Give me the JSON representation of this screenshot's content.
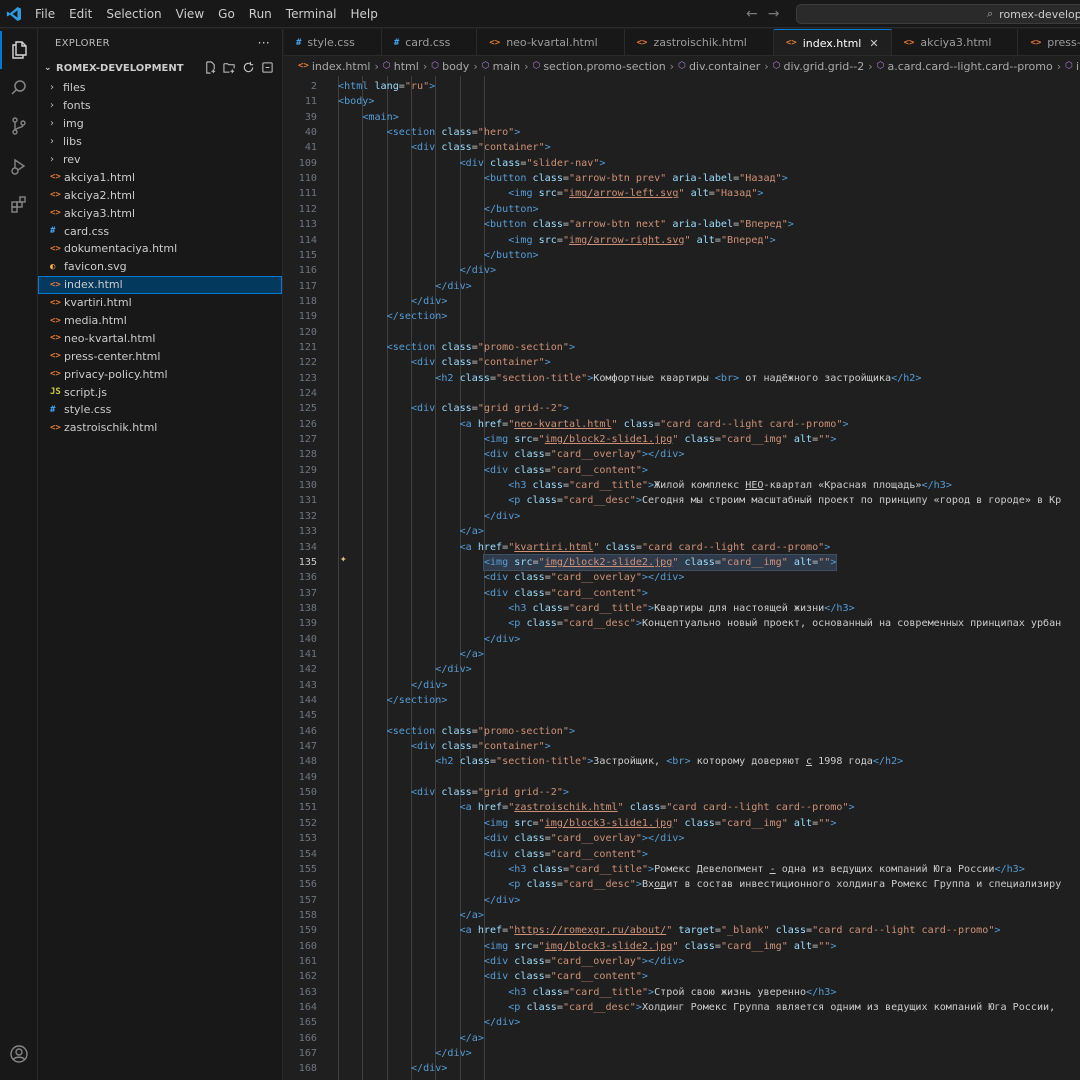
{
  "menu": [
    "File",
    "Edit",
    "Selection",
    "View",
    "Go",
    "Run",
    "Terminal",
    "Help"
  ],
  "command_center": "romex-developme",
  "sidebar": {
    "title": "EXPLORER",
    "section": "ROMEX-DEVELOPMENT",
    "items": [
      {
        "label": "files",
        "kind": "folder"
      },
      {
        "label": "fonts",
        "kind": "folder"
      },
      {
        "label": "img",
        "kind": "folder"
      },
      {
        "label": "libs",
        "kind": "folder"
      },
      {
        "label": "rev",
        "kind": "folder"
      },
      {
        "label": "akciya1.html",
        "kind": "html"
      },
      {
        "label": "akciya2.html",
        "kind": "html"
      },
      {
        "label": "akciya3.html",
        "kind": "html"
      },
      {
        "label": "card.css",
        "kind": "css"
      },
      {
        "label": "dokumentaciya.html",
        "kind": "html"
      },
      {
        "label": "favicon.svg",
        "kind": "svg"
      },
      {
        "label": "index.html",
        "kind": "html",
        "selected": true
      },
      {
        "label": "kvartiri.html",
        "kind": "html"
      },
      {
        "label": "media.html",
        "kind": "html"
      },
      {
        "label": "neo-kvartal.html",
        "kind": "html"
      },
      {
        "label": "press-center.html",
        "kind": "html"
      },
      {
        "label": "privacy-policy.html",
        "kind": "html"
      },
      {
        "label": "script.js",
        "kind": "js"
      },
      {
        "label": "style.css",
        "kind": "css"
      },
      {
        "label": "zastroischik.html",
        "kind": "html"
      }
    ]
  },
  "tabs": [
    {
      "label": "style.css",
      "kind": "css"
    },
    {
      "label": "card.css",
      "kind": "css"
    },
    {
      "label": "neo-kvartal.html",
      "kind": "html"
    },
    {
      "label": "zastroischik.html",
      "kind": "html"
    },
    {
      "label": "index.html",
      "kind": "html",
      "active": true
    },
    {
      "label": "akciya3.html",
      "kind": "html"
    },
    {
      "label": "press-center.html",
      "kind": "html"
    }
  ],
  "breadcrumb": [
    "index.html",
    "html",
    "body",
    "main",
    "section.promo-section",
    "div.container",
    "div.grid.grid--2",
    "a.card.card--light.card--promo",
    "img.card_"
  ],
  "current_line": "135",
  "code_lines": [
    {
      "n": "2",
      "i": 0,
      "h": "<t>&lt;html</t> <a>lang</a>=<s>\"ru\"</s><t>&gt;</t>"
    },
    {
      "n": "11",
      "i": 0,
      "h": "<t>&lt;body&gt;</t>"
    },
    {
      "n": "39",
      "i": 1,
      "h": "<t>&lt;main&gt;</t>"
    },
    {
      "n": "40",
      "i": 2,
      "h": "<t>&lt;section</t> <a>class</a>=<s>\"hero\"</s><t>&gt;</t>"
    },
    {
      "n": "41",
      "i": 3,
      "h": "<t>&lt;div</t> <a>class</a>=<s>\"container\"</s><t>&gt;</t>"
    },
    {
      "n": "109",
      "i": 5,
      "h": "<t>&lt;div</t> <a>class</a>=<s>\"slider-nav\"</s><t>&gt;</t>"
    },
    {
      "n": "110",
      "i": 6,
      "h": "<t>&lt;button</t> <a>class</a>=<s>\"arrow-btn prev\"</s> <a>aria-label</a>=<s>\"Назад\"</s><t>&gt;</t>"
    },
    {
      "n": "111",
      "i": 7,
      "h": "<t>&lt;img</t> <a>src</a>=<s>\"<u>img/arrow-left.svg</u>\"</s> <a>alt</a>=<s>\"Назад\"</s><t>&gt;</t>"
    },
    {
      "n": "112",
      "i": 6,
      "h": "<t>&lt;/button&gt;</t>"
    },
    {
      "n": "113",
      "i": 6,
      "h": "<t>&lt;button</t> <a>class</a>=<s>\"arrow-btn next\"</s> <a>aria-label</a>=<s>\"Вперед\"</s><t>&gt;</t>"
    },
    {
      "n": "114",
      "i": 7,
      "h": "<t>&lt;img</t> <a>src</a>=<s>\"<u>img/arrow-right.svg</u>\"</s> <a>alt</a>=<s>\"Вперед\"</s><t>&gt;</t>"
    },
    {
      "n": "115",
      "i": 6,
      "h": "<t>&lt;/button&gt;</t>"
    },
    {
      "n": "116",
      "i": 5,
      "h": "<t>&lt;/div&gt;</t>"
    },
    {
      "n": "117",
      "i": 4,
      "h": "<t>&lt;/div&gt;</t>"
    },
    {
      "n": "118",
      "i": 3,
      "h": "<t>&lt;/div&gt;</t>"
    },
    {
      "n": "119",
      "i": 2,
      "h": "<t>&lt;/section&gt;</t>"
    },
    {
      "n": "120",
      "i": 0,
      "h": ""
    },
    {
      "n": "121",
      "i": 2,
      "h": "<t>&lt;section</t> <a>class</a>=<s>\"promo-section\"</s><t>&gt;</t>"
    },
    {
      "n": "122",
      "i": 3,
      "h": "<t>&lt;div</t> <a>class</a>=<s>\"container\"</s><t>&gt;</t>"
    },
    {
      "n": "123",
      "i": 4,
      "h": "<t>&lt;h2</t> <a>class</a>=<s>\"section-title\"</s><t>&gt;</t>Комфортные квартиры <t>&lt;br&gt;</t> от надёжного застройщика<t>&lt;/h2&gt;</t>"
    },
    {
      "n": "124",
      "i": 0,
      "h": ""
    },
    {
      "n": "125",
      "i": 3,
      "h": "<t>&lt;div</t> <a>class</a>=<s>\"grid grid--2\"</s><t>&gt;</t>"
    },
    {
      "n": "126",
      "i": 5,
      "h": "<t>&lt;a</t> <a>href</a>=<s>\"<u>neo-kvartal.html</u>\"</s> <a>class</a>=<s>\"card card--light card--promo\"</s><t>&gt;</t>"
    },
    {
      "n": "127",
      "i": 6,
      "h": "<t>&lt;img</t> <a>src</a>=<s>\"<u>img/block2-slide1.jpg</u>\"</s> <a>class</a>=<s>\"card__img\"</s> <a>alt</a>=<s>\"\"</s><t>&gt;</t>"
    },
    {
      "n": "128",
      "i": 6,
      "h": "<t>&lt;div</t> <a>class</a>=<s>\"card__overlay\"</s><t>&gt;&lt;/div&gt;</t>"
    },
    {
      "n": "129",
      "i": 6,
      "h": "<t>&lt;div</t> <a>class</a>=<s>\"card__content\"</s><t>&gt;</t>"
    },
    {
      "n": "130",
      "i": 7,
      "h": "<t>&lt;h3</t> <a>class</a>=<s>\"card__title\"</s><t>&gt;</t>Жилой комплекс <u>НЕО</u>-квартал «Красная площадь»<t>&lt;/h3&gt;</t>"
    },
    {
      "n": "131",
      "i": 7,
      "h": "<t>&lt;p</t> <a>class</a>=<s>\"card__desc\"</s><t>&gt;</t>Сегодня мы строим масштабный проект по принципу «город в городе» в Кр"
    },
    {
      "n": "132",
      "i": 6,
      "h": "<t>&lt;/div&gt;</t>"
    },
    {
      "n": "133",
      "i": 5,
      "h": "<t>&lt;/a&gt;</t>"
    },
    {
      "n": "134",
      "i": 5,
      "h": "<t>&lt;a</t> <a>href</a>=<s>\"<u>kvartiri.html</u>\"</s> <a>class</a>=<s>\"card card--light card--promo\"</s><t>&gt;</t>"
    },
    {
      "n": "135",
      "i": 6,
      "hl": true,
      "h": "<t>&lt;img</t> <a>src</a>=<s>\"<u>img/block2-slide2.jpg</u>\"</s> <a>class</a>=<s>\"card__img\"</s> <a>alt</a>=<s>\"\"</s><t>&gt;</t>"
    },
    {
      "n": "136",
      "i": 6,
      "h": "<t>&lt;div</t> <a>class</a>=<s>\"card__overlay\"</s><t>&gt;&lt;/div&gt;</t>"
    },
    {
      "n": "137",
      "i": 6,
      "h": "<t>&lt;div</t> <a>class</a>=<s>\"card__content\"</s><t>&gt;</t>"
    },
    {
      "n": "138",
      "i": 7,
      "h": "<t>&lt;h3</t> <a>class</a>=<s>\"card__title\"</s><t>&gt;</t>Квартиры для настоящей жизни<t>&lt;/h3&gt;</t>"
    },
    {
      "n": "139",
      "i": 7,
      "h": "<t>&lt;p</t> <a>class</a>=<s>\"card__desc\"</s><t>&gt;</t>Концептуально новый проект, основанный на современных принципах урбан"
    },
    {
      "n": "140",
      "i": 6,
      "h": "<t>&lt;/div&gt;</t>"
    },
    {
      "n": "141",
      "i": 5,
      "h": "<t>&lt;/a&gt;</t>"
    },
    {
      "n": "142",
      "i": 4,
      "h": "<t>&lt;/div&gt;</t>"
    },
    {
      "n": "143",
      "i": 3,
      "h": "<t>&lt;/div&gt;</t>"
    },
    {
      "n": "144",
      "i": 2,
      "h": "<t>&lt;/section&gt;</t>"
    },
    {
      "n": "145",
      "i": 0,
      "h": ""
    },
    {
      "n": "146",
      "i": 2,
      "h": "<t>&lt;section</t> <a>class</a>=<s>\"promo-section\"</s><t>&gt;</t>"
    },
    {
      "n": "147",
      "i": 3,
      "h": "<t>&lt;div</t> <a>class</a>=<s>\"container\"</s><t>&gt;</t>"
    },
    {
      "n": "148",
      "i": 4,
      "h": "<t>&lt;h2</t> <a>class</a>=<s>\"section-title\"</s><t>&gt;</t>Застройщик, <t>&lt;br&gt;</t> которому доверяют <u>с</u> 1998 года<t>&lt;/h2&gt;</t>"
    },
    {
      "n": "149",
      "i": 0,
      "h": ""
    },
    {
      "n": "150",
      "i": 3,
      "h": "<t>&lt;div</t> <a>class</a>=<s>\"grid grid--2\"</s><t>&gt;</t>"
    },
    {
      "n": "151",
      "i": 5,
      "h": "<t>&lt;a</t> <a>href</a>=<s>\"<u>zastroischik.html</u>\"</s> <a>class</a>=<s>\"card card--light card--promo\"</s><t>&gt;</t>"
    },
    {
      "n": "152",
      "i": 6,
      "h": "<t>&lt;img</t> <a>src</a>=<s>\"<u>img/block3-slide1.jpg</u>\"</s> <a>class</a>=<s>\"card__img\"</s> <a>alt</a>=<s>\"\"</s><t>&gt;</t>"
    },
    {
      "n": "153",
      "i": 6,
      "h": "<t>&lt;div</t> <a>class</a>=<s>\"card__overlay\"</s><t>&gt;&lt;/div&gt;</t>"
    },
    {
      "n": "154",
      "i": 6,
      "h": "<t>&lt;div</t> <a>class</a>=<s>\"card__content\"</s><t>&gt;</t>"
    },
    {
      "n": "155",
      "i": 7,
      "h": "<t>&lt;h3</t> <a>class</a>=<s>\"card__title\"</s><t>&gt;</t>Ромекс Девелопмент <u>-</u> одна из ведущих компаний Юга России<t>&lt;/h3&gt;</t>"
    },
    {
      "n": "156",
      "i": 7,
      "h": "<t>&lt;p</t> <a>class</a>=<s>\"card__desc\"</s><t>&gt;</t>Вх<u>од</u>ит в состав инвестиционного холдинга Ромекс Группа и специализиру"
    },
    {
      "n": "157",
      "i": 6,
      "h": "<t>&lt;/div&gt;</t>"
    },
    {
      "n": "158",
      "i": 5,
      "h": "<t>&lt;/a&gt;</t>"
    },
    {
      "n": "159",
      "i": 5,
      "h": "<t>&lt;a</t> <a>href</a>=<s>\"<u>https://romexgr.ru/about/</u>\"</s> <a>target</a>=<s>\"_blank\"</s> <a>class</a>=<s>\"card card--light card--promo\"</s><t>&gt;</t>"
    },
    {
      "n": "160",
      "i": 6,
      "h": "<t>&lt;img</t> <a>src</a>=<s>\"<u>img/block3-slide2.jpg</u>\"</s> <a>class</a>=<s>\"card__img\"</s> <a>alt</a>=<s>\"\"</s><t>&gt;</t>"
    },
    {
      "n": "161",
      "i": 6,
      "h": "<t>&lt;div</t> <a>class</a>=<s>\"card__overlay\"</s><t>&gt;&lt;/div&gt;</t>"
    },
    {
      "n": "162",
      "i": 6,
      "h": "<t>&lt;div</t> <a>class</a>=<s>\"card__content\"</s><t>&gt;</t>"
    },
    {
      "n": "163",
      "i": 7,
      "h": "<t>&lt;h3</t> <a>class</a>=<s>\"card__title\"</s><t>&gt;</t>Строй свою жизнь уверенно<t>&lt;/h3&gt;</t>"
    },
    {
      "n": "164",
      "i": 7,
      "h": "<t>&lt;p</t> <a>class</a>=<s>\"card__desc\"</s><t>&gt;</t>Холдинг Ромекс Группа является одним из ведущих компаний Юга России,"
    },
    {
      "n": "165",
      "i": 6,
      "h": "<t>&lt;/div&gt;</t>"
    },
    {
      "n": "166",
      "i": 5,
      "h": "<t>&lt;/a&gt;</t>"
    },
    {
      "n": "167",
      "i": 4,
      "h": "<t>&lt;/div&gt;</t>"
    },
    {
      "n": "168",
      "i": 3,
      "h": "<t>&lt;/div&gt;</t>"
    }
  ],
  "colors": {
    "accent": "#0078d4",
    "tag": "#569cd6",
    "attr": "#9cdcfe",
    "string": "#ce9178"
  }
}
